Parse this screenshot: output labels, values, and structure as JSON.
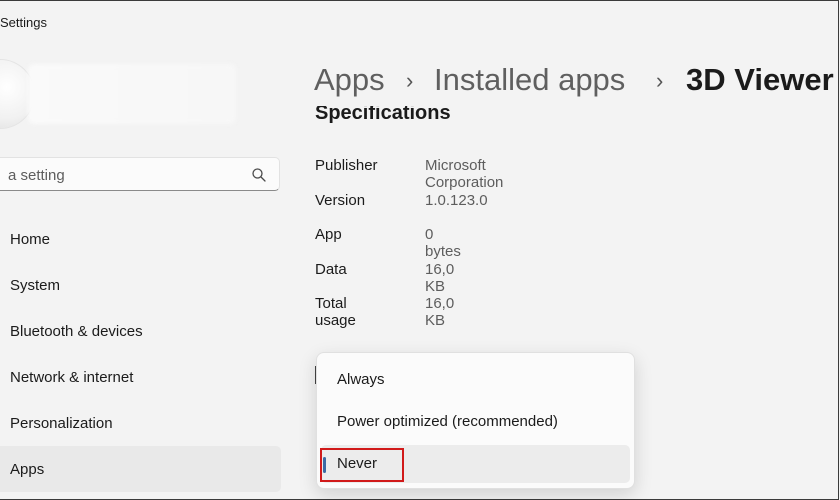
{
  "window": {
    "title": "Settings"
  },
  "search": {
    "placeholder": "a setting"
  },
  "nav": {
    "items": [
      {
        "label": "Home"
      },
      {
        "label": "System"
      },
      {
        "label": "Bluetooth & devices"
      },
      {
        "label": "Network & internet"
      },
      {
        "label": "Personalization"
      },
      {
        "label": "Apps"
      }
    ],
    "active": "Apps"
  },
  "breadcrumb": {
    "items": [
      "Apps",
      "Installed apps",
      "3D Viewer"
    ],
    "separator": "›"
  },
  "section": {
    "title": "Specifications"
  },
  "specs": [
    {
      "label": "Publisher",
      "value": "Microsoft Corporation"
    },
    {
      "label": "Version",
      "value": "1.0.123.0"
    },
    {
      "label": "App",
      "value": "0 bytes"
    },
    {
      "label": "Data",
      "value": "16,0 KB"
    },
    {
      "label": "Total usage",
      "value": "16,0 KB"
    }
  ],
  "dropdown": {
    "options": [
      {
        "label": "Always"
      },
      {
        "label": "Power optimized (recommended)"
      },
      {
        "label": "Never"
      }
    ],
    "selected": "Never"
  },
  "colors": {
    "accent": "#3c6aa3",
    "highlight": "#d11a1a"
  }
}
